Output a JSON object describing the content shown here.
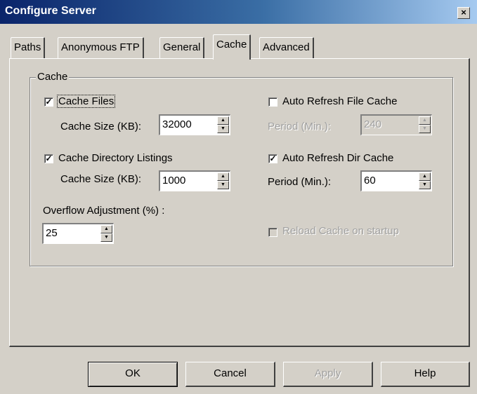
{
  "window": {
    "title": "Configure Server",
    "close_glyph": "×"
  },
  "tabs": [
    {
      "label": "Paths"
    },
    {
      "label": "Anonymous FTP"
    },
    {
      "label": "General"
    },
    {
      "label": "Cache",
      "active": true
    },
    {
      "label": "Advanced"
    }
  ],
  "cache": {
    "group_label": "Cache",
    "cache_files": {
      "label": "Cache Files",
      "checked": true
    },
    "cache_files_size": {
      "label": "Cache Size (KB):",
      "value": "32000"
    },
    "cache_dir": {
      "label": "Cache Directory Listings",
      "checked": true
    },
    "cache_dir_size": {
      "label": "Cache Size (KB):",
      "value": "1000"
    },
    "overflow": {
      "label": "Overflow Adjustment (%) :",
      "value": "25"
    },
    "auto_refresh_file": {
      "label": "Auto Refresh File Cache",
      "checked": false
    },
    "file_period": {
      "label": "Period (Min.):",
      "value": "240",
      "disabled": true
    },
    "auto_refresh_dir": {
      "label": "Auto Refresh Dir Cache",
      "checked": true
    },
    "dir_period": {
      "label": "Period (Min.):",
      "value": "60"
    },
    "reload": {
      "label": "Reload Cache on startup",
      "checked": false,
      "disabled": true
    }
  },
  "check_glyph": "✓",
  "icons": {
    "spin_up": "spin-up-arrow-icon",
    "spin_down": "spin-down-arrow-icon"
  },
  "spin_glyphs": {
    "up": "▲",
    "down": "▼"
  },
  "buttons": {
    "ok": "OK",
    "cancel": "Cancel",
    "apply": "Apply",
    "help": "Help"
  },
  "colors": {
    "face": "#d4d0c8",
    "title_start": "#0a246a",
    "title_end": "#a6caf0"
  }
}
